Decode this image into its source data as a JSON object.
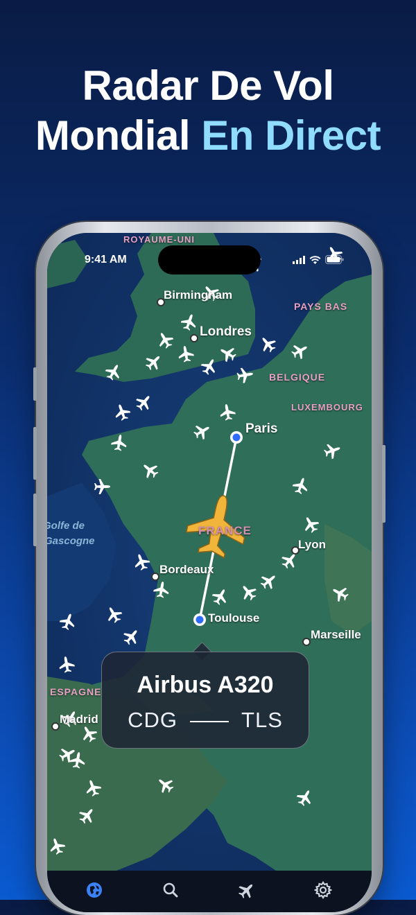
{
  "headline": {
    "line1": "Radar De Vol",
    "line2_plain": "Mondial",
    "line2_accent": "En Direct"
  },
  "status_bar": {
    "time": "9:41 AM",
    "icons": [
      "signal-icon",
      "wifi-icon",
      "battery-icon"
    ]
  },
  "map": {
    "cities": [
      "Birmingham",
      "Londres",
      "Paris",
      "Bordeaux",
      "Lyon",
      "Toulouse",
      "Marseille",
      "Madrid"
    ],
    "countries": [
      "ROYAUME-UNI",
      "PAYS BAS",
      "BELGIQUE",
      "LUXEMBOURG",
      "FRANCE",
      "ESPAGNE"
    ],
    "seas": [
      "Golfe de",
      "Gascogne"
    ],
    "route": {
      "origin": "Paris",
      "destination": "Toulouse"
    }
  },
  "flight_card": {
    "model": "Airbus A320",
    "origin_code": "CDG",
    "destination_code": "TLS"
  },
  "tabs": [
    {
      "name": "globe-icon",
      "active": true
    },
    {
      "name": "search-icon",
      "active": false
    },
    {
      "name": "plane-icon",
      "active": false
    },
    {
      "name": "gear-icon",
      "active": false
    }
  ],
  "colors": {
    "accent": "#8fdcff",
    "route": "#ffffff",
    "airport_dot": "#2f6bff",
    "selected_plane": "#f0b53a",
    "active_tab": "#3b82f6"
  }
}
